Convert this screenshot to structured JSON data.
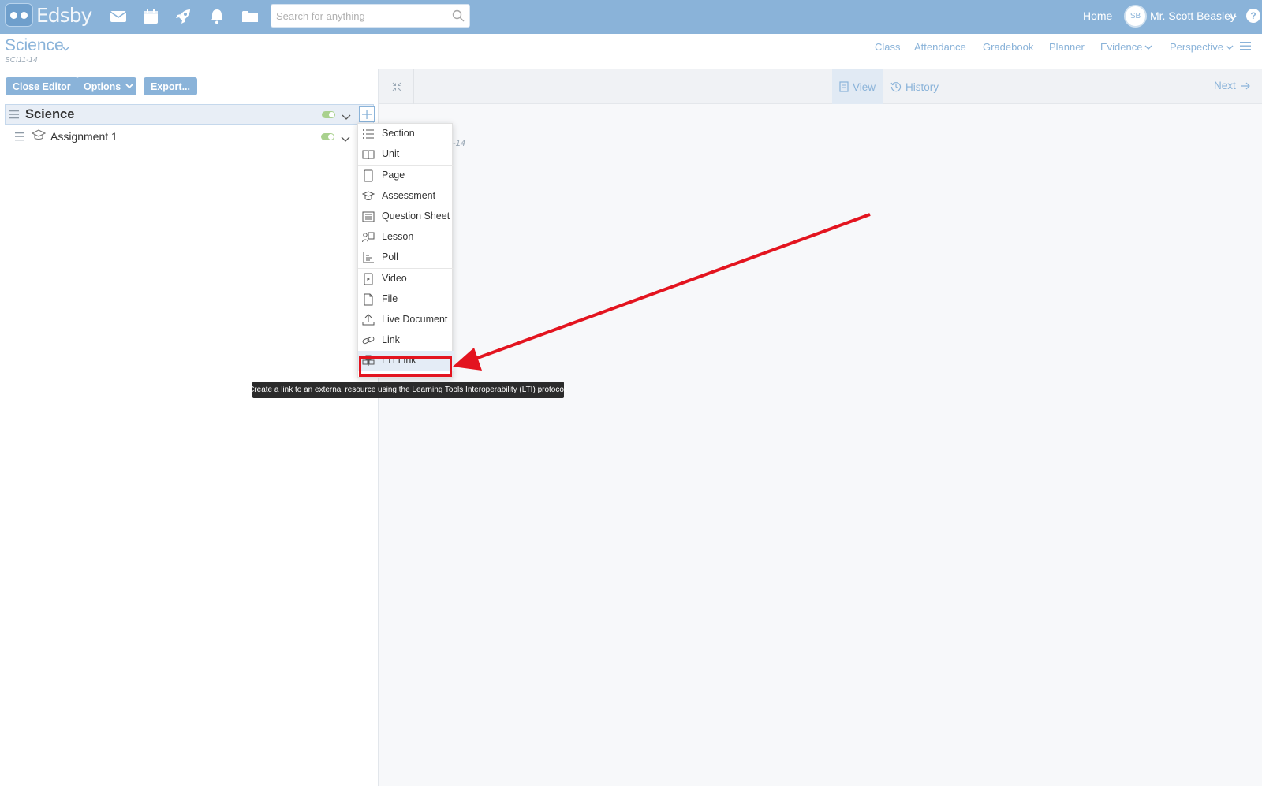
{
  "app": {
    "logo_text": "Edsby"
  },
  "topbar": {
    "search_placeholder": "Search for anything",
    "home_label": "Home",
    "avatar_initials": "SB",
    "user_name": "Mr. Scott Beasley",
    "help_label": "?"
  },
  "class_header": {
    "title": "Science",
    "code": "SCI11-14",
    "tabs": [
      {
        "label": "Class"
      },
      {
        "label": "Attendance"
      },
      {
        "label": "Gradebook"
      },
      {
        "label": "Planner"
      },
      {
        "label": "Evidence"
      },
      {
        "label": "Perspective"
      }
    ]
  },
  "editor": {
    "close_editor": "Close Editor",
    "options": "Options",
    "export": "Export...",
    "tree": {
      "root_title": "Science",
      "items": [
        {
          "title": "Assignment 1"
        }
      ]
    }
  },
  "right_panel": {
    "view_label": "View",
    "history_label": "History",
    "next_label": "Next",
    "content_code_partial": "-14"
  },
  "add_menu": {
    "groups": [
      [
        {
          "label": "Section",
          "icon": "list-icon"
        },
        {
          "label": "Unit",
          "icon": "book-icon"
        }
      ],
      [
        {
          "label": "Page",
          "icon": "page-icon"
        },
        {
          "label": "Assessment",
          "icon": "graduation-cap-icon"
        },
        {
          "label": "Question Sheet",
          "icon": "question-sheet-icon"
        },
        {
          "label": "Lesson",
          "icon": "lesson-icon"
        },
        {
          "label": "Poll",
          "icon": "poll-icon"
        }
      ],
      [
        {
          "label": "Video",
          "icon": "video-icon"
        },
        {
          "label": "File",
          "icon": "file-icon"
        },
        {
          "label": "Live Document",
          "icon": "upload-icon"
        },
        {
          "label": "Link",
          "icon": "link-icon"
        },
        {
          "label": "LTI Link",
          "icon": "lti-icon"
        }
      ]
    ],
    "highlighted": "LTI Link"
  },
  "tooltip": {
    "text": "Create a link to an external resource using the Learning Tools Interoperability (LTI) protocol."
  },
  "colors": {
    "topbar": "#8ab3d9",
    "accent": "#8ab3d9",
    "annotation_red": "#e3141f",
    "toggle_on": "#a9d18e"
  }
}
